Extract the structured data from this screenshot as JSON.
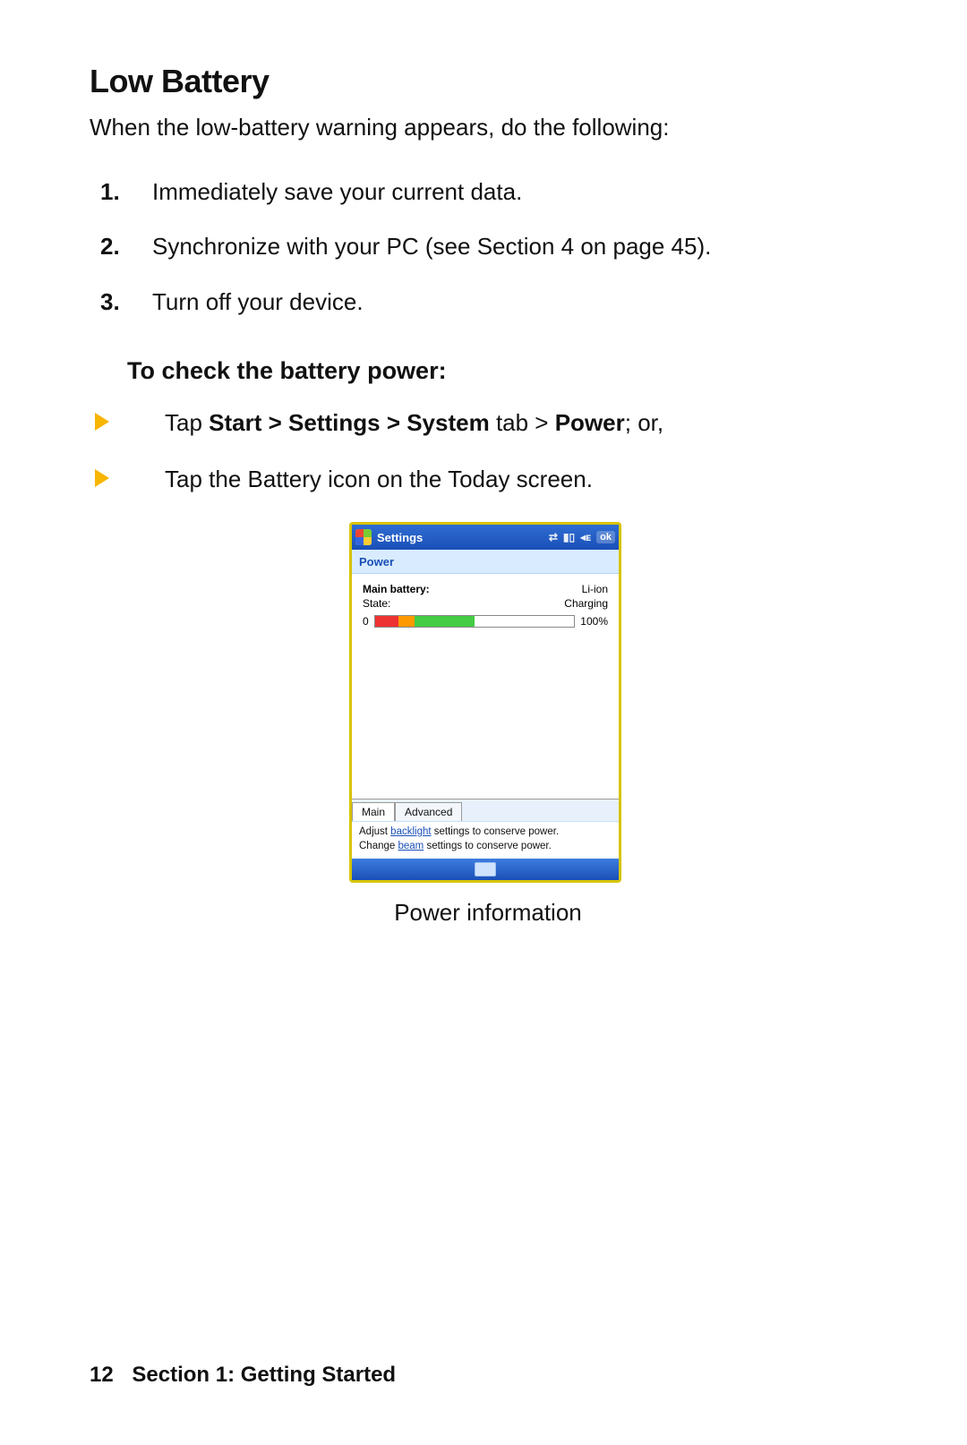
{
  "heading": "Low Battery",
  "intro": "When the low-battery warning appears, do the following:",
  "steps": [
    {
      "num": "1.",
      "text": "Immediately save your current data."
    },
    {
      "num": "2.",
      "text": "Synchronize with your PC (see Section 4 on page 45)."
    },
    {
      "num": "3.",
      "text": "Turn off your device."
    }
  ],
  "sub": "To check the battery power:",
  "bullets": [
    {
      "pre": "Tap ",
      "b1": "Start > Settings > System",
      "mid": " tab > ",
      "b2": "Power",
      "post": "; or,"
    },
    {
      "plain": "Tap the Battery icon on the Today screen."
    }
  ],
  "device": {
    "title": "Settings",
    "ok": "ok",
    "subheader": "Power",
    "main_label": "Main battery:",
    "type": "Li-ion",
    "state_label": "State:",
    "state": "Charging",
    "zero": "0",
    "pct": "100%",
    "tab_main": "Main",
    "tab_adv": "Advanced",
    "hint1_a": "Adjust ",
    "hint1_link": "backlight",
    "hint1_b": " settings to conserve power.",
    "hint2_a": "Change ",
    "hint2_link": "beam",
    "hint2_b": " settings to conserve power."
  },
  "caption": "Power information",
  "footer": {
    "page": "12",
    "section": "Section 1: Getting Started"
  }
}
